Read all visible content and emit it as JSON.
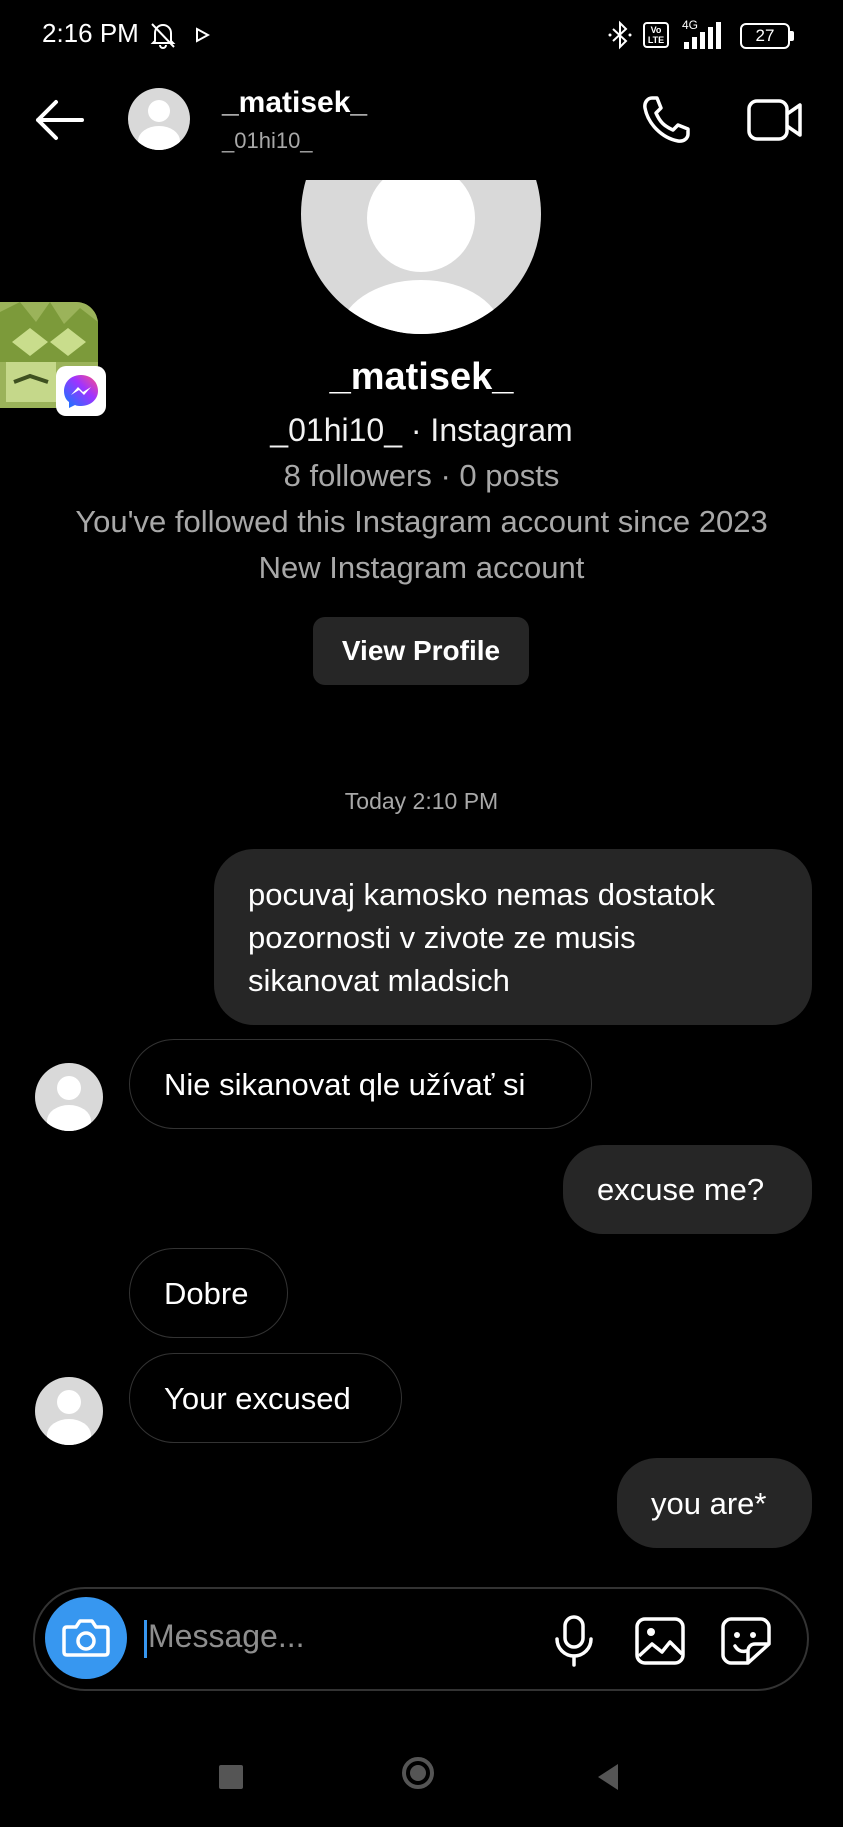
{
  "status_bar": {
    "time": "2:16 PM",
    "network": "4G",
    "volte": "Vo LTE",
    "battery": "27"
  },
  "header": {
    "name": "_matisek_",
    "username": "_01hi10_"
  },
  "profile": {
    "name": "_matisek_",
    "handle": "_01hi10_ · Instagram",
    "stats": "8 followers · 0 posts",
    "follow_info": "You've followed this Instagram account since 2023",
    "new_account": "New Instagram account",
    "view_profile_label": "View Profile"
  },
  "chat": {
    "timestamp": "Today 2:10 PM",
    "messages": [
      {
        "direction": "sent",
        "lines": [
          "pocuvaj kamosko nemas dostatok",
          "pozornosti v zivote ze musis",
          "sikanovat mladsich"
        ]
      },
      {
        "direction": "received",
        "text": "Nie sikanovat qle užívať si"
      },
      {
        "direction": "sent",
        "text": "excuse me?"
      },
      {
        "direction": "received",
        "text": "Dobre"
      },
      {
        "direction": "received",
        "text": "Your excused"
      },
      {
        "direction": "sent",
        "text": "you are*"
      }
    ]
  },
  "composer": {
    "placeholder": "Message..."
  },
  "colors": {
    "background": "#000000",
    "sent_bubble": "#262626",
    "accent": "#3797f0",
    "secondary_text": "#a8a8a8"
  },
  "icons": [
    "back-arrow-icon",
    "phone-icon",
    "video-camera-icon",
    "camera-icon",
    "microphone-icon",
    "gallery-icon",
    "sticker-icon",
    "messenger-icon",
    "bluetooth-icon",
    "signal-icon",
    "battery-icon",
    "mute-bell-icon"
  ]
}
